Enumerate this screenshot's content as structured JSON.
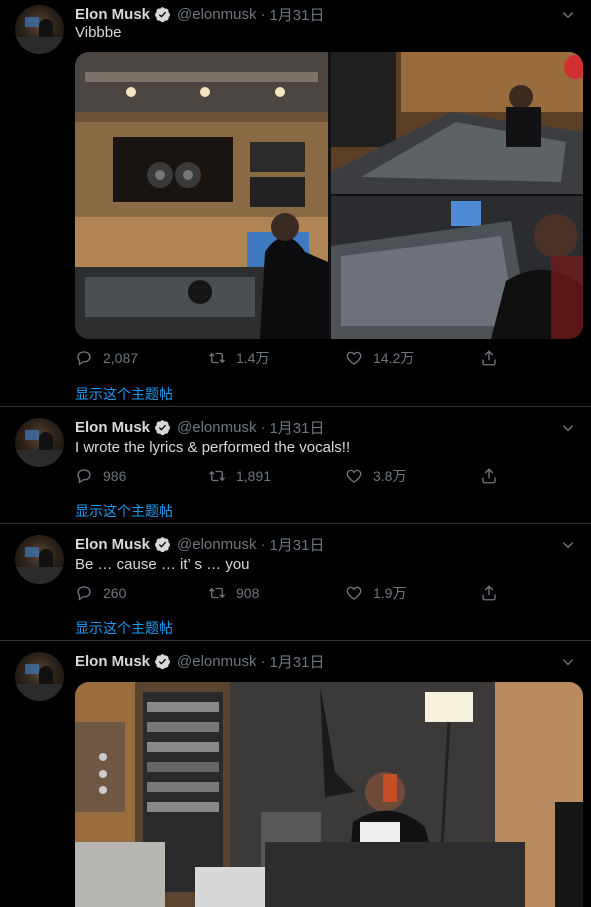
{
  "tweets": [
    {
      "name": "Elon Musk",
      "handle": "@elonmusk",
      "dot": "·",
      "date": "1月31日",
      "text": "Vibbbe",
      "replies": "2,087",
      "retweets": "1.4万",
      "likes": "14.2万",
      "show_thread": "显示这个主题帖"
    },
    {
      "name": "Elon Musk",
      "handle": "@elonmusk",
      "dot": "·",
      "date": "1月31日",
      "text": "I wrote the lyrics & performed the vocals!!",
      "replies": "986",
      "retweets": "1,891",
      "likes": "3.8万",
      "show_thread": "显示这个主题帖"
    },
    {
      "name": "Elon Musk",
      "handle": "@elonmusk",
      "dot": "·",
      "date": "1月31日",
      "text": "Be … cause … it’ s … you",
      "replies": "260",
      "retweets": "908",
      "likes": "1.9万",
      "show_thread": "显示这个主题帖"
    },
    {
      "name": "Elon Musk",
      "handle": "@elonmusk",
      "dot": "·",
      "date": "1月31日"
    }
  ],
  "colors": {
    "background": "#000000",
    "muted": "#6e767d",
    "link": "#1d9bf0",
    "verified": "#d9d9d9"
  },
  "icons": [
    "verified-badge-icon",
    "chevron-down-icon",
    "reply-icon",
    "retweet-icon",
    "like-icon",
    "share-icon"
  ]
}
